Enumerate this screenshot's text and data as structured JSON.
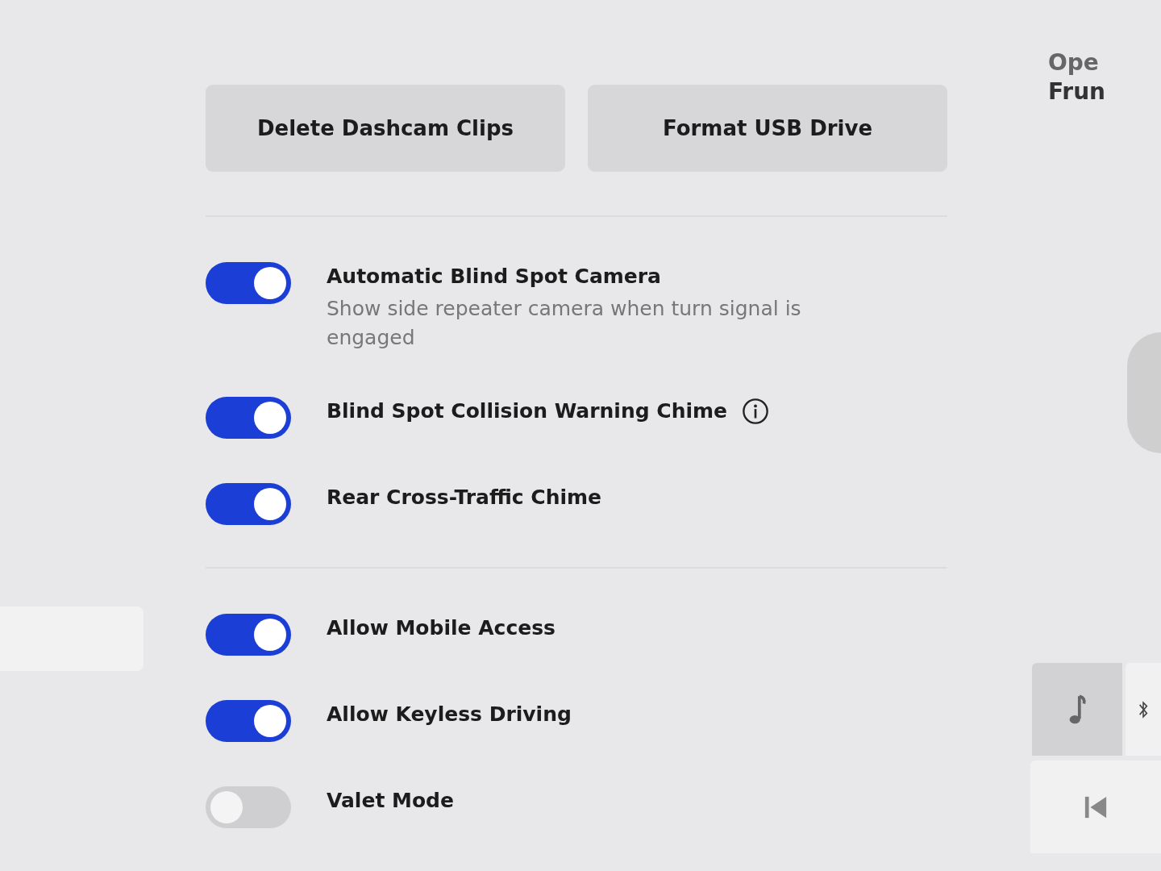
{
  "buttons": [
    {
      "label": "Delete Dashcam Clips"
    },
    {
      "label": "Format USB Drive"
    }
  ],
  "groups": [
    [
      {
        "title": "Automatic Blind Spot Camera",
        "description": "Show side repeater camera when turn signal is engaged",
        "on": true,
        "info": false
      },
      {
        "title": "Blind Spot Collision Warning Chime",
        "on": true,
        "info": true
      },
      {
        "title": "Rear Cross-Traffic Chime",
        "on": true,
        "info": false
      }
    ],
    [
      {
        "title": "Allow Mobile Access",
        "on": true,
        "info": false
      },
      {
        "title": "Allow Keyless Driving",
        "on": true,
        "info": false
      },
      {
        "title": "Valet Mode",
        "on": false,
        "info": false
      }
    ]
  ],
  "right_panel": {
    "label_lines": [
      "Ope",
      "Frun"
    ]
  }
}
